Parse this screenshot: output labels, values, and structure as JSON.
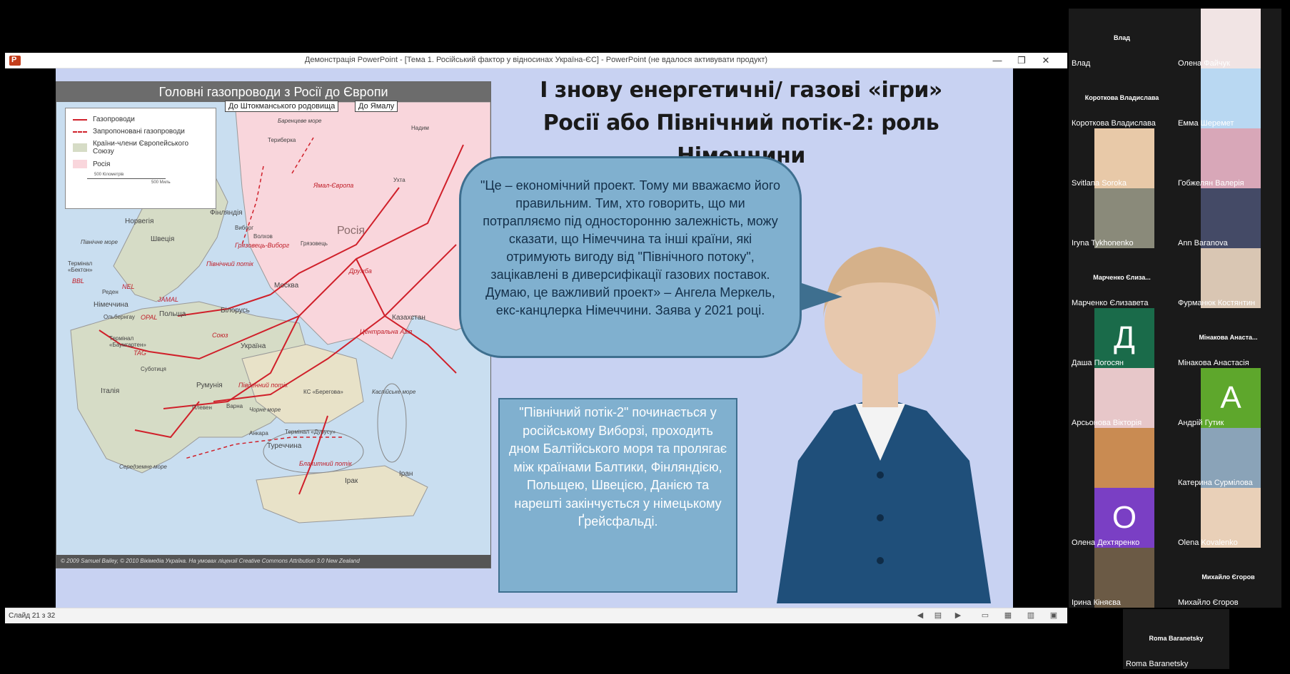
{
  "window": {
    "title": "Демонстрація PowerPoint - [Тема 1. Російський фактор у відносинах Україна-ЄС] - PowerPoint (не вдалося активувати продукт)",
    "min": "—",
    "restore": "❐",
    "close": "✕"
  },
  "slide": {
    "title": "І знову енергетичні/ газові «ігри» Росії або Північний потік-2: роль Німеччини",
    "quote": "\"Це – економічний проект. Тому ми вважаємо його правильним. Тим, хто говорить, що ми потрапляємо під односторонню залежність, можу сказати, що Німеччина та інші країни, які отримують вигоду від \"Північного потоку\", зацікавлені в диверсифікації газових поставок. Думаю, це важливий проект» – Ангела Меркель, екс-канцлерка Німеччини. Заява у 2021 році.",
    "info": "\"Північний потік-2\" починається у російському Виборзі, проходить дном Балтійського моря та пролягає між країнами Балтики, Фінляндією, Польщею, Швецією, Данією та нарешті закінчується у німецькому Ґрейсфальді."
  },
  "map": {
    "header": "Головні газопроводи з Росії до Європи",
    "callout1": "До Штокманського родовища",
    "callout2": "До Ямалу",
    "legend": {
      "pipelines": "Газопроводи",
      "proposed": "Запропоновані газопроводи",
      "eu": "Країни-члени Європейського Союзу",
      "russia": "Росія",
      "scale_km": "500 Кілометрів",
      "scale_mi": "500 Миль"
    },
    "labels": {
      "russia": "Росія",
      "moscow": "Москва",
      "ukraine": "Україна",
      "belarus": "Білорусь",
      "poland": "Польща",
      "finland": "Фінляндія",
      "sweden": "Швеція",
      "norway": "Норвегія",
      "kazakhstan": "Казахстан",
      "turkey": "Туреччина",
      "iraq": "Ірак",
      "iran": "Іран",
      "romania": "Румунія",
      "italy": "Італія",
      "germany": "Німеччина",
      "barents": "Баренцеве море",
      "north_sea": "Північне море",
      "black_sea": "Чорне море",
      "caspian": "Каспійське море",
      "med": "Середземне море",
      "nadym": "Надим",
      "ukhta": "Ухта",
      "teriberka": "Териберка",
      "vyborg": "Виборг",
      "volkhov": "Волхов",
      "gryazovets": "Грязовець",
      "varna": "Варна",
      "pleven": "Плевен",
      "ankara": "Анкара",
      "beregovaya": "КС «Берегова»",
      "durusu": "Термінал «Дурусу»",
      "bacton": "Термінал «Бектон»",
      "baumgarten": "Термінал «Баумгартен»",
      "reden": "Реден",
      "olbernhau": "Ольбернгау",
      "subotica": "Суботиця"
    },
    "pipes": {
      "jamal": "JAMAL",
      "nel": "NEL",
      "opal": "OPAL",
      "bbl": "BBL",
      "tag": "TAG",
      "soyuz": "Союз",
      "druzhba": "Дружба",
      "blue_stream": "Блакитний потік",
      "south_stream": "Південний потік",
      "north_stream": "Північний потік",
      "central_asia": "Центральна Азія",
      "yamal_europe": "Ямал-Європа",
      "gryazovets_vyborg": "Грязовець-Виборг"
    },
    "footer": "© 2009 Samuel Bailey, © 2010 Вікімедіа Україна. На умовах ліцензії Creative Commons Attribution 3.0 New Zealand"
  },
  "statusbar": {
    "slide_counter": "Слайд 21 з 32"
  },
  "participants": [
    {
      "name": "Влад",
      "header": "Влад",
      "type": "name"
    },
    {
      "name": "Олена Файчук",
      "type": "video",
      "color": "#f1e4e4"
    },
    {
      "name": "Короткова Владислава",
      "header": "Короткова Владислава",
      "type": "name"
    },
    {
      "name": "Емма Шеремет",
      "type": "video",
      "color": "#b9d8f2"
    },
    {
      "name": "Svitlana Soroka",
      "type": "video",
      "color": "#e8c9a8"
    },
    {
      "name": "Гобжелян Валерія",
      "type": "video",
      "color": "#d8a7b8"
    },
    {
      "name": "Iryna Tykhonenko",
      "type": "video",
      "color": "#8a8a7a"
    },
    {
      "name": "Ann Baranova",
      "type": "video",
      "color": "#444a66"
    },
    {
      "name": "Марченко Єлизавета",
      "header": "Марченко Єлиза...",
      "type": "name"
    },
    {
      "name": "Фурманюк Костянтин",
      "type": "video",
      "color": "#d9c6b3"
    },
    {
      "name": "Даша Погосян",
      "type": "avatar",
      "letter": "Д",
      "color": "#1a6b4a"
    },
    {
      "name": "Мінакова Анастасія",
      "header": "Мінакова Анаста...",
      "type": "name"
    },
    {
      "name": "Арсьонова Вікторія",
      "type": "video",
      "color": "#e7c7c9"
    },
    {
      "name": "Андрій Гутик",
      "type": "avatar",
      "letter": "А",
      "color": "#5ea72c"
    },
    {
      "name": "",
      "type": "video",
      "color": "#c98b52"
    },
    {
      "name": "Катерина Сурмілова",
      "type": "video",
      "color": "#8aa3b8"
    },
    {
      "name": "Олена Дехтяренко",
      "type": "avatar",
      "letter": "О",
      "color": "#7a3fc4"
    },
    {
      "name": "Olena Kovalenko",
      "type": "video",
      "color": "#e9d0b8"
    },
    {
      "name": "Ірина Кіняєва",
      "type": "video",
      "color": "#6b5a45"
    },
    {
      "name": "Михайло Єгоров",
      "header": "Михайло Єгоров",
      "type": "name"
    },
    {
      "name": "Roma Baranetsky",
      "header": "Roma Baranetsky",
      "type": "name"
    }
  ]
}
